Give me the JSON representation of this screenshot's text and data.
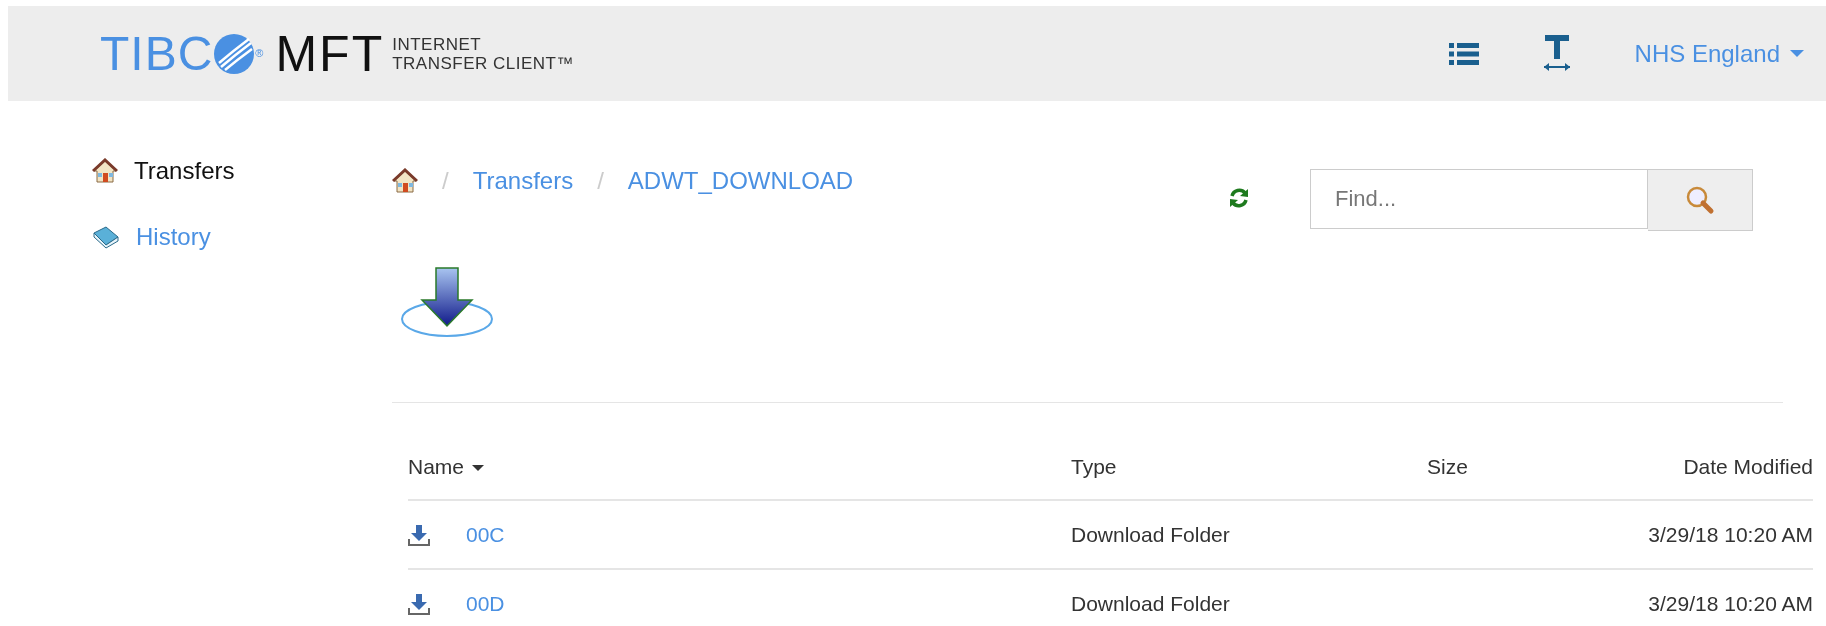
{
  "header": {
    "brand": "TIBC",
    "registered": "®",
    "product": "MFT",
    "tagline": [
      "INTERNET",
      "TRANSFER CLIENT™"
    ],
    "user_menu": "NHS England"
  },
  "sidebar": {
    "items": [
      {
        "label": "Transfers",
        "selected": true
      },
      {
        "label": "History",
        "selected": false
      }
    ]
  },
  "breadcrumb": [
    {
      "separator": "/",
      "label": "Transfers"
    },
    {
      "separator": "/",
      "label": "ADWT_DOWNLOAD"
    }
  ],
  "search": {
    "placeholder": "Find..."
  },
  "table": {
    "columns": [
      {
        "label": "Name",
        "sorted": true
      },
      {
        "label": "Type",
        "sorted": false
      },
      {
        "label": "Size",
        "sorted": false
      },
      {
        "label": "Date Modified",
        "sorted": false
      }
    ],
    "rows": [
      {
        "name": "00C",
        "type": "Download Folder",
        "modified": "3/29/18 10:20 AM"
      },
      {
        "name": "00D",
        "type": "Download Folder",
        "modified": "3/29/18 10:20 AM"
      }
    ]
  }
}
